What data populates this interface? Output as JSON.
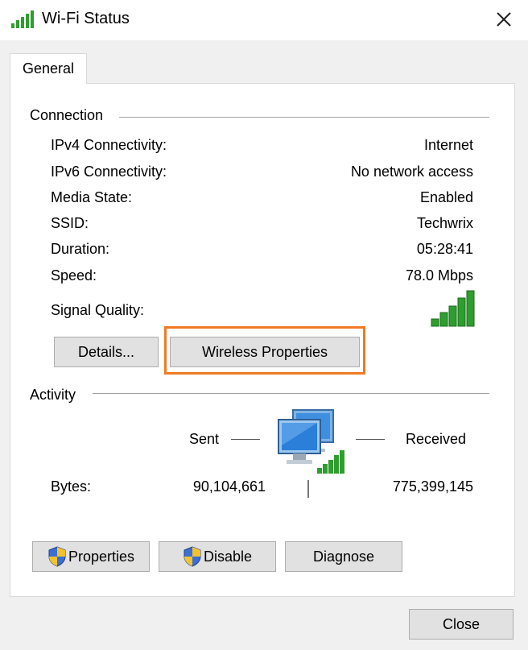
{
  "window": {
    "title": "Wi-Fi Status",
    "close_icon": "close-icon"
  },
  "tabs": [
    {
      "label": "General",
      "selected": true
    }
  ],
  "connection": {
    "group_label": "Connection",
    "rows": [
      {
        "label": "IPv4 Connectivity:",
        "value": "Internet"
      },
      {
        "label": "IPv6 Connectivity:",
        "value": "No network access"
      },
      {
        "label": "Media State:",
        "value": "Enabled"
      },
      {
        "label": "SSID:",
        "value": "Techwrix"
      },
      {
        "label": "Duration:",
        "value": "05:28:41"
      },
      {
        "label": "Speed:",
        "value": "78.0 Mbps"
      }
    ],
    "signal_label": "Signal Quality:",
    "signal_bars": 5,
    "details_button": "Details...",
    "wireless_properties_button": "Wireless Properties"
  },
  "activity": {
    "group_label": "Activity",
    "sent_label": "Sent",
    "received_label": "Received",
    "bytes_label": "Bytes:",
    "bytes_sent": "90,104,661",
    "bytes_received": "775,399,145"
  },
  "buttons": {
    "properties": "Properties",
    "disable": "Disable",
    "diagnose": "Diagnose",
    "close": "Close"
  },
  "colors": {
    "highlight": "#f07a22",
    "signal_green": "#2e9e2e",
    "dialog_bg": "#f0f0f0"
  }
}
